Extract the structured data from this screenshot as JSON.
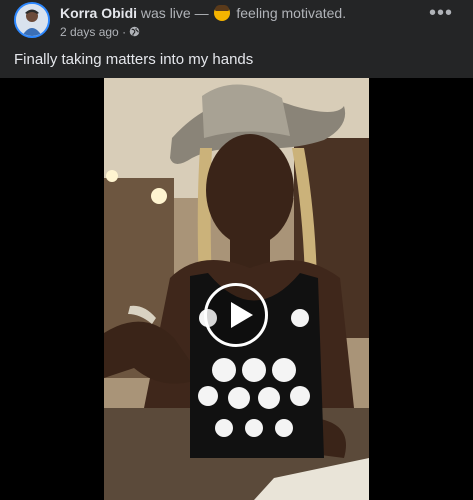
{
  "post": {
    "author": "Korra Obidi",
    "activity": "was live —",
    "feeling": "feeling motivated.",
    "time": "2 days ago",
    "separator": "·",
    "more_label": "•••",
    "text": "Finally taking matters into my hands"
  },
  "icons": {
    "globe": "globe-icon",
    "play": "play-icon",
    "more": "more-options-icon",
    "feeling": "smiling-face-icon"
  },
  "colors": {
    "background": "#242526",
    "text_primary": "#e4e6eb",
    "text_secondary": "#b0b3b8",
    "avatar_ring": "#2d88ff"
  }
}
